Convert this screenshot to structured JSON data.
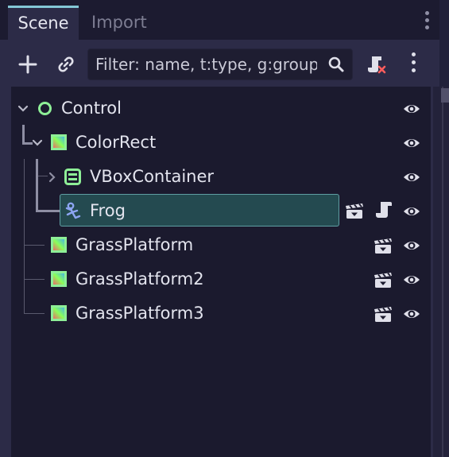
{
  "tabs": [
    {
      "label": "Scene",
      "active": true
    },
    {
      "label": "Import",
      "active": false
    }
  ],
  "toolbar": {
    "add_icon": "plus-icon",
    "link_icon": "link-icon",
    "filter_placeholder": "Filter: name, t:type, g:group",
    "filter_value": "",
    "search_icon": "search-icon",
    "script_remove_icon": "script-remove-icon",
    "more_icon": "kebab-menu-icon"
  },
  "tree": {
    "nodes": [
      {
        "name": "Control",
        "icon": "control-node-icon",
        "expanded": true,
        "selected": false,
        "visible": true
      },
      {
        "name": "ColorRect",
        "icon": "colorrect-node-icon",
        "expanded": true,
        "selected": false,
        "visible": true
      },
      {
        "name": "VBoxContainer",
        "icon": "vboxcontainer-icon",
        "expanded": false,
        "selected": false,
        "visible": true
      },
      {
        "name": "Frog",
        "icon": "sprite-node-icon",
        "selected": true,
        "instanced_scene": true,
        "has_script": true,
        "visible": true
      },
      {
        "name": "GrassPlatform",
        "icon": "colorrect-node-icon",
        "instanced_scene": true,
        "visible": true
      },
      {
        "name": "GrassPlatform2",
        "icon": "colorrect-node-icon",
        "instanced_scene": true,
        "visible": true
      },
      {
        "name": "GrassPlatform3",
        "icon": "colorrect-node-icon",
        "instanced_scene": true,
        "visible": true
      }
    ]
  },
  "colors": {
    "accent": "#84c8d6",
    "selection": "#244a50",
    "control_green": "#8eef97",
    "panel": "#2c2b47",
    "tree_bg": "#1b1a2e"
  }
}
